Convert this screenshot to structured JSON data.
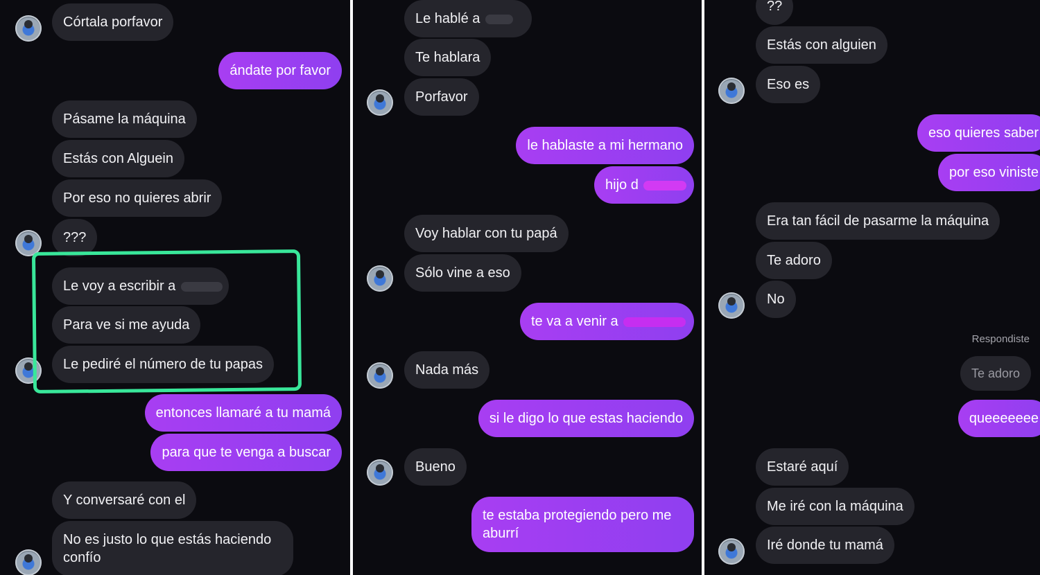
{
  "panel1": {
    "messages": [
      "Córtala porfavor",
      "ándate por favor",
      "Pásame la máquina",
      "Estás con Alguein",
      "Por eso no quieres abrir",
      "???",
      "Le voy a escribir a",
      "Para ve si me ayuda",
      "Le pediré el número de tu papas",
      "entonces llamaré a tu mamá",
      "para que te venga a buscar",
      "Y conversaré con el",
      "No es justo lo que estás haciendo confío"
    ]
  },
  "panel2": {
    "messages": [
      "Le hablé a",
      "Te hablara",
      "Porfavor",
      "le hablaste a mi hermano",
      "hijo d",
      "Voy hablar con tu papá",
      "Sólo vine a eso",
      "te va a venir a",
      "Nada más",
      "si le digo lo que estas haciendo",
      "Bueno",
      "te estaba protegiendo pero me aburrí"
    ]
  },
  "panel3": {
    "messages": [
      "??",
      "Estás con alguien",
      "Eso es",
      "eso quieres saber",
      "por eso viniste",
      "Era tan fácil de pasarme la máquina",
      "Te adoro",
      "No",
      "Te adoro",
      "queeeeeee",
      "Estaré aquí",
      "Me iré con la máquina",
      "Iré donde tu mamá"
    ],
    "reply_label": "Respondiste"
  },
  "colors": {
    "background": "#0b0b10",
    "incoming_bubble": "#25252c",
    "outgoing_bubble": "#9d3ff2",
    "highlight_outline": "#39e79a"
  },
  "icons": [
    "avatar-photo"
  ]
}
